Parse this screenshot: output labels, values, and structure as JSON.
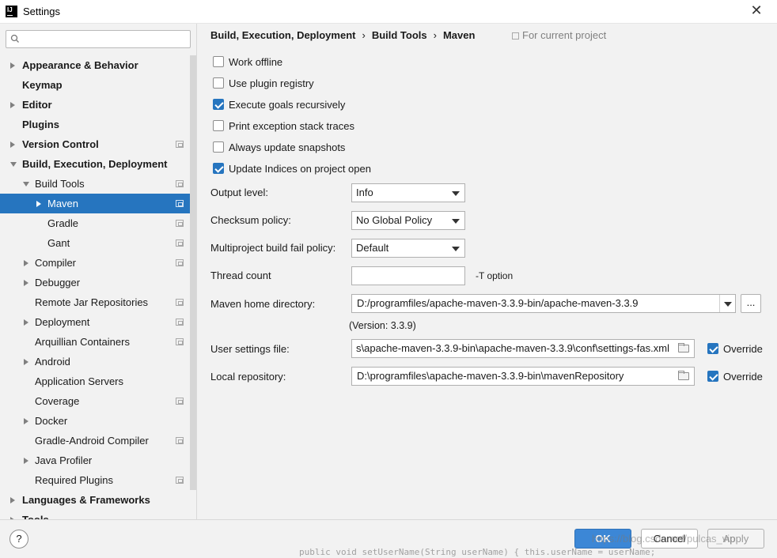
{
  "window": {
    "title": "Settings"
  },
  "search": {
    "placeholder": ""
  },
  "sidebar": {
    "items": [
      {
        "label": "Appearance & Behavior"
      },
      {
        "label": "Keymap"
      },
      {
        "label": "Editor"
      },
      {
        "label": "Plugins"
      },
      {
        "label": "Version Control"
      },
      {
        "label": "Build, Execution, Deployment"
      },
      {
        "label": "Build Tools"
      },
      {
        "label": "Maven"
      },
      {
        "label": "Gradle"
      },
      {
        "label": "Gant"
      },
      {
        "label": "Compiler"
      },
      {
        "label": "Debugger"
      },
      {
        "label": "Remote Jar Repositories"
      },
      {
        "label": "Deployment"
      },
      {
        "label": "Arquillian Containers"
      },
      {
        "label": "Android"
      },
      {
        "label": "Application Servers"
      },
      {
        "label": "Coverage"
      },
      {
        "label": "Docker"
      },
      {
        "label": "Gradle-Android Compiler"
      },
      {
        "label": "Java Profiler"
      },
      {
        "label": "Required Plugins"
      },
      {
        "label": "Languages & Frameworks"
      },
      {
        "label": "Tools"
      }
    ]
  },
  "breadcrumb": {
    "part1": "Build, Execution, Deployment",
    "part2": "Build Tools",
    "part3": "Maven",
    "sep": "›",
    "scope": "For current project"
  },
  "options": {
    "work_offline": {
      "label": "Work offline",
      "checked": false
    },
    "use_plugin_registry": {
      "label": "Use plugin registry",
      "checked": false
    },
    "execute_goals_recursively": {
      "label": "Execute goals recursively",
      "checked": true
    },
    "print_exception_stack_traces": {
      "label": "Print exception stack traces",
      "checked": false
    },
    "always_update_snapshots": {
      "label": "Always update snapshots",
      "checked": false
    },
    "update_indices": {
      "label": "Update Indices on project open",
      "checked": true
    }
  },
  "fields": {
    "output_level": {
      "label": "Output level:",
      "value": "Info"
    },
    "checksum_policy": {
      "label": "Checksum policy:",
      "value": "No Global Policy"
    },
    "multiproject_fail_policy": {
      "label": "Multiproject build fail policy:",
      "value": "Default"
    },
    "thread_count": {
      "label": "Thread count",
      "value": "",
      "hint": "-T option"
    },
    "maven_home": {
      "label": "Maven home directory:",
      "value": "D:/programfiles/apache-maven-3.3.9-bin/apache-maven-3.3.9",
      "version": "(Version: 3.3.9)",
      "browse": "..."
    },
    "user_settings": {
      "label": "User settings file:",
      "value": "s\\apache-maven-3.3.9-bin\\apache-maven-3.3.9\\conf\\settings-fas.xml",
      "override": "Override",
      "override_checked": true
    },
    "local_repository": {
      "label": "Local repository:",
      "value": "D:\\programfiles\\apache-maven-3.3.9-bin\\mavenRepository",
      "override": "Override",
      "override_checked": true
    }
  },
  "footer": {
    "help": "?",
    "ok": "OK",
    "cancel": "Cancel",
    "apply": "Apply",
    "watermark": "https://blog.csdn.net/pulcas_vip"
  },
  "background_code": "public void setUserName(String userName) {  this.userName = userName;"
}
